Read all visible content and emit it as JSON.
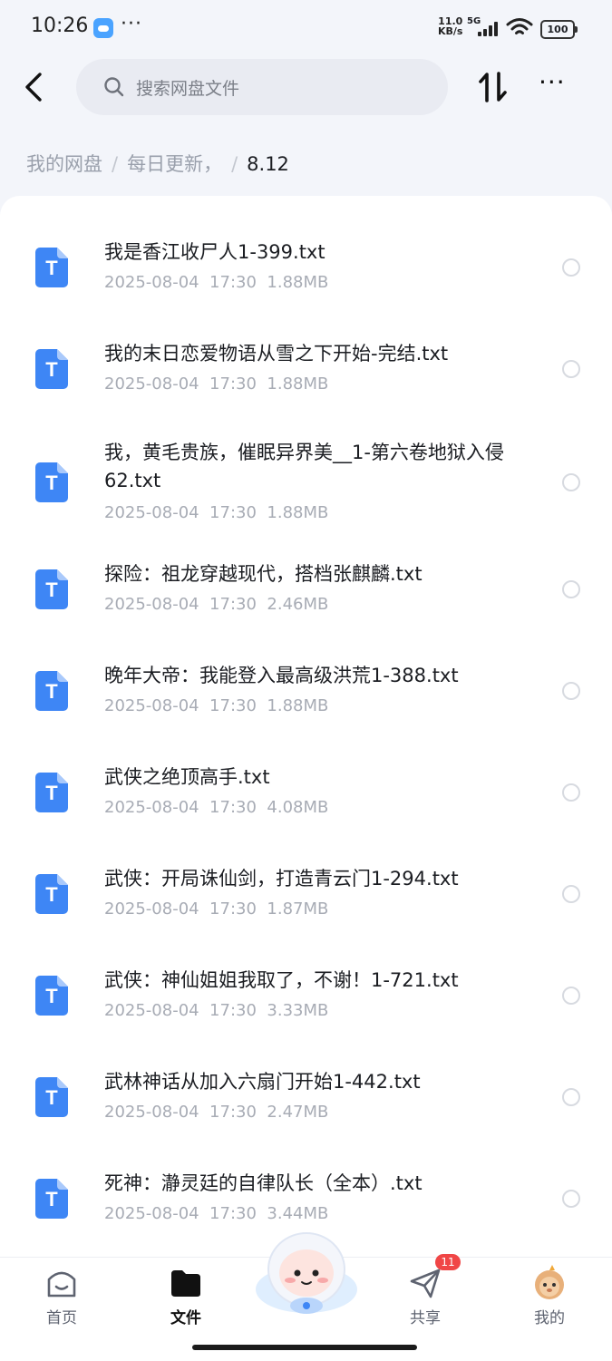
{
  "status_bar": {
    "time": "10:26",
    "more_dots": "···",
    "net_speed_value": "11.0",
    "net_speed_unit": "KB/s",
    "network": "5G",
    "battery": "100"
  },
  "header": {
    "search_placeholder": "搜索网盘文件",
    "more_label": "···"
  },
  "breadcrumb": [
    {
      "label": "我的网盘"
    },
    {
      "label": "每日更新，"
    },
    {
      "label": "8.12"
    }
  ],
  "breadcrumb_separator": "/",
  "files": [
    {
      "name": "我是香江收尸人1-399.txt",
      "date": "2025-08-04  17:30",
      "size": "1.88MB"
    },
    {
      "name": "我的末日恋爱物语从雪之下开始-完结.txt",
      "date": "2025-08-04  17:30",
      "size": "1.88MB"
    },
    {
      "name": "我，黄毛贵族，催眠异界美__1-第六卷地狱入侵62.txt",
      "date": "2025-08-04  17:30",
      "size": "1.88MB"
    },
    {
      "name": "探险：祖龙穿越现代，搭档张麒麟.txt",
      "date": "2025-08-04  17:30",
      "size": "2.46MB"
    },
    {
      "name": "晚年大帝：我能登入最高级洪荒1-388.txt",
      "date": "2025-08-04  17:30",
      "size": "1.88MB"
    },
    {
      "name": "武侠之绝顶高手.txt",
      "date": "2025-08-04  17:30",
      "size": "4.08MB"
    },
    {
      "name": "武侠：开局诛仙剑，打造青云门1-294.txt",
      "date": "2025-08-04  17:30",
      "size": "1.87MB"
    },
    {
      "name": "武侠：神仙姐姐我取了，不谢！1-721.txt",
      "date": "2025-08-04  17:30",
      "size": "3.33MB"
    },
    {
      "name": "武林神话从加入六扇门开始1-442.txt",
      "date": "2025-08-04  17:30",
      "size": "2.47MB"
    },
    {
      "name": "死神：瀞灵廷的自律队长（全本）.txt",
      "date": "2025-08-04  17:30",
      "size": "3.44MB"
    }
  ],
  "file_icon_letter": "T",
  "bottom_nav": [
    {
      "label": "首页",
      "icon": "home-icon"
    },
    {
      "label": "文件",
      "icon": "folder-icon",
      "active": true
    },
    {
      "label": "共享",
      "icon": "send-icon",
      "badge": "11"
    },
    {
      "label": "我的",
      "icon": "avatar-icon"
    }
  ],
  "colors": {
    "accent": "#3e86f5",
    "background": "#f3f5fa",
    "badge": "#f04646"
  }
}
